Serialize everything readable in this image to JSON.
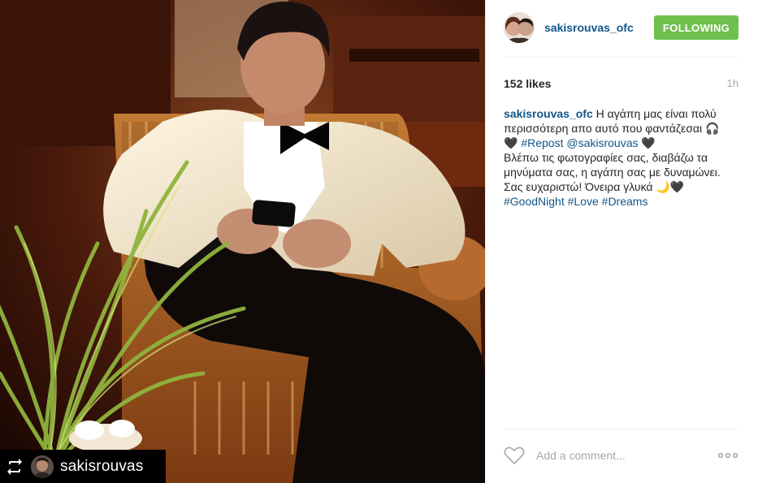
{
  "post": {
    "owner": {
      "username": "sakisrouvas_ofc",
      "follow_label": "FOLLOWING"
    },
    "likes": "152 likes",
    "timestamp": "1h",
    "caption": {
      "username": "sakisrouvas_ofc",
      "line1": "Η αγάπη μας είναι πολύ περισσότερη απο αυτό που φαντάζεσαι 🎧",
      "heart1": "🖤",
      "repost_tag": "#Repost",
      "mention": "@sakisrouvas",
      "heart2": "🖤",
      "line2": "Βλέπω τις φωτογραφίες σας, διαβάζω τα μηνύματα σας, η αγάπη σας με δυναμώνει. Σας ευχαριστώ! Όνειρα γλυκά 🌙🖤",
      "tags": [
        "#GoodNight",
        "#Love",
        "#Dreams"
      ]
    },
    "photo_overlay": {
      "repost_username": "sakisrouvas",
      "repost_icon": "repost-icon"
    },
    "comment": {
      "placeholder": "Add a comment...",
      "like_icon": "heart-outline-icon",
      "more_icon": "ellipsis-icon"
    }
  },
  "colors": {
    "link_blue": "#125688",
    "follow_green": "#70c050",
    "muted_gray": "#a5a7aa"
  }
}
